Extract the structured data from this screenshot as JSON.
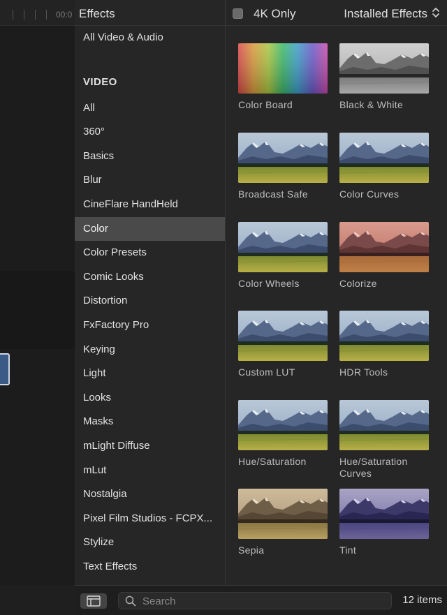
{
  "timeline": {
    "timecode": "00:0"
  },
  "header": {
    "title": "Effects",
    "filter_label": "4K Only",
    "filter_checked": false,
    "source_select": "Installed Effects"
  },
  "categories": [
    {
      "label": "All Video & Audio",
      "type": "item"
    },
    {
      "label": "VIDEO",
      "type": "section"
    },
    {
      "label": "All",
      "type": "item"
    },
    {
      "label": "360°",
      "type": "item"
    },
    {
      "label": "Basics",
      "type": "item"
    },
    {
      "label": "Blur",
      "type": "item"
    },
    {
      "label": "CineFlare HandHeld",
      "type": "item"
    },
    {
      "label": "Color",
      "type": "item",
      "selected": true
    },
    {
      "label": "Color Presets",
      "type": "item"
    },
    {
      "label": "Comic Looks",
      "type": "item"
    },
    {
      "label": "Distortion",
      "type": "item"
    },
    {
      "label": "FxFactory Pro",
      "type": "item"
    },
    {
      "label": "Keying",
      "type": "item"
    },
    {
      "label": "Light",
      "type": "item"
    },
    {
      "label": "Looks",
      "type": "item"
    },
    {
      "label": "Masks",
      "type": "item"
    },
    {
      "label": "mLight Diffuse",
      "type": "item"
    },
    {
      "label": "mLut",
      "type": "item"
    },
    {
      "label": "Nostalgia",
      "type": "item"
    },
    {
      "label": "Pixel Film Studios - FCPX...",
      "type": "item"
    },
    {
      "label": "Stylize",
      "type": "item"
    },
    {
      "label": "Text Effects",
      "type": "item"
    }
  ],
  "effects": [
    {
      "label": "Color Board",
      "thumb": "rainbow",
      "name": "color-board"
    },
    {
      "label": "Black & White",
      "thumb": "bw",
      "name": "black-white"
    },
    {
      "label": "Broadcast Safe",
      "thumb": "normal",
      "name": "broadcast-safe"
    },
    {
      "label": "Color Curves",
      "thumb": "normal",
      "name": "color-curves"
    },
    {
      "label": "Color Wheels",
      "thumb": "normal",
      "name": "color-wheels"
    },
    {
      "label": "Colorize",
      "thumb": "colorize",
      "name": "colorize"
    },
    {
      "label": "Custom LUT",
      "thumb": "normal",
      "name": "custom-lut"
    },
    {
      "label": "HDR Tools",
      "thumb": "normal",
      "name": "hdr-tools"
    },
    {
      "label": "Hue/Saturation",
      "thumb": "normal",
      "name": "hue-saturation"
    },
    {
      "label": "Hue/Saturation Curves",
      "thumb": "normal",
      "name": "hue-saturation-curves"
    },
    {
      "label": "Sepia",
      "thumb": "sepia",
      "name": "sepia"
    },
    {
      "label": "Tint",
      "thumb": "tint",
      "name": "tint"
    }
  ],
  "footer": {
    "search_placeholder": "Search",
    "item_count": "12 items"
  },
  "colors": {
    "panel_bg": "#262626",
    "selected_bg": "#4a4a4a",
    "text": "#e2e2e2",
    "label_text": "#bdbdbd"
  },
  "icons": {
    "layout_toggle": "sidebar-layout-icon",
    "search": "magnifier-icon",
    "select_chevron": "up-down-chevron-icon"
  }
}
